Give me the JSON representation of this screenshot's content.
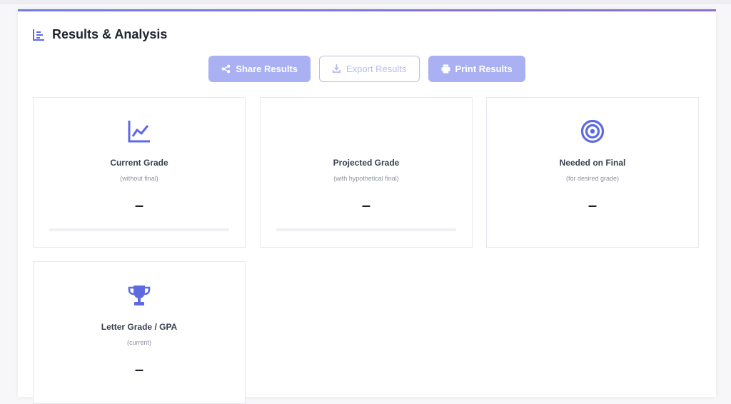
{
  "section": {
    "title": "Results & Analysis",
    "icon": "chart-list-icon"
  },
  "actions": {
    "share": {
      "label": "Share Results",
      "icon": "share-icon"
    },
    "export": {
      "label": "Export Results",
      "icon": "download-icon"
    },
    "print": {
      "label": "Print Results",
      "icon": "printer-icon"
    }
  },
  "cards": [
    {
      "title": "Current Grade",
      "subtitle": "(without final)",
      "value": "–",
      "icon": "line-chart-icon"
    },
    {
      "title": "Projected Grade",
      "subtitle": "(with hypothetical final)",
      "value": "–",
      "icon": ""
    },
    {
      "title": "Needed on Final",
      "subtitle": "(for desired grade)",
      "value": "–",
      "icon": "target-icon"
    },
    {
      "title": "Letter Grade / GPA",
      "subtitle": "(current)",
      "value": "–",
      "icon": "trophy-icon"
    }
  ],
  "colors": {
    "accent": "#6f7be9",
    "button_filled": "#a9b1f3",
    "button_outline": "#b8bee9"
  }
}
